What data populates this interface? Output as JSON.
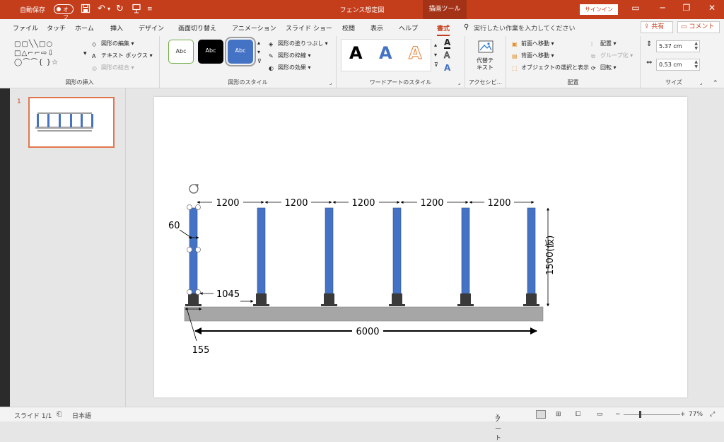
{
  "titlebar": {
    "autosave_label": "自動保存",
    "autosave_state": "オフ",
    "doc_title": "フェンス想定図",
    "context_tab": "描画ツール",
    "signin_label": "サインイン"
  },
  "tabs": [
    {
      "label": "ファイル"
    },
    {
      "label": "タッチ"
    },
    {
      "label": "ホーム"
    },
    {
      "label": "挿入"
    },
    {
      "label": "デザイン"
    },
    {
      "label": "画面切り替え"
    },
    {
      "label": "アニメーション"
    },
    {
      "label": "スライド ショー"
    },
    {
      "label": "校閲"
    },
    {
      "label": "表示"
    },
    {
      "label": "ヘルプ"
    },
    {
      "label": "書式"
    }
  ],
  "tell_me": "実行したい作業を入力してください",
  "share_label": "共有",
  "comment_label": "コメント",
  "ribbon": {
    "insert_shapes": {
      "label": "図形の挿入",
      "edit_shape": "図形の編集",
      "text_box": "テキスト ボックス",
      "merge_shapes": "図形の結合"
    },
    "shape_styles": {
      "label": "図形のスタイル",
      "style_sample": "Abc",
      "fill": "図形の塗りつぶし",
      "outline": "図形の枠線",
      "effects": "図形の効果"
    },
    "wordart": {
      "label": "ワードアートのスタイル",
      "letter": "A"
    },
    "accessibility": {
      "label": "アクセシビ...",
      "alt_text_line1": "代替テ",
      "alt_text_line2": "キスト"
    },
    "arrange": {
      "label": "配置",
      "bring_forward": "前面へ移動",
      "send_backward": "背面へ移動",
      "selection_pane": "オブジェクトの選択と表示",
      "align": "配置",
      "group": "グループ化",
      "rotate": "回転"
    },
    "size": {
      "label": "サイズ",
      "height": "5.37 cm",
      "width": "0.53 cm"
    }
  },
  "slides_panel": {
    "slide_number": "1"
  },
  "drawing": {
    "spacing_label": "1200",
    "width_label": "60",
    "height_label": "1500(仮)",
    "post_height_label": "1045",
    "total_label": "6000",
    "base_label": "155",
    "post_color": "#4472c4",
    "base_color": "#a6a6a6"
  },
  "statusbar": {
    "slide_info": "スライド 1/1",
    "language": "日本語",
    "notes": "ノート",
    "zoom": "77%"
  },
  "colors": {
    "accent": "#c43e1c"
  }
}
